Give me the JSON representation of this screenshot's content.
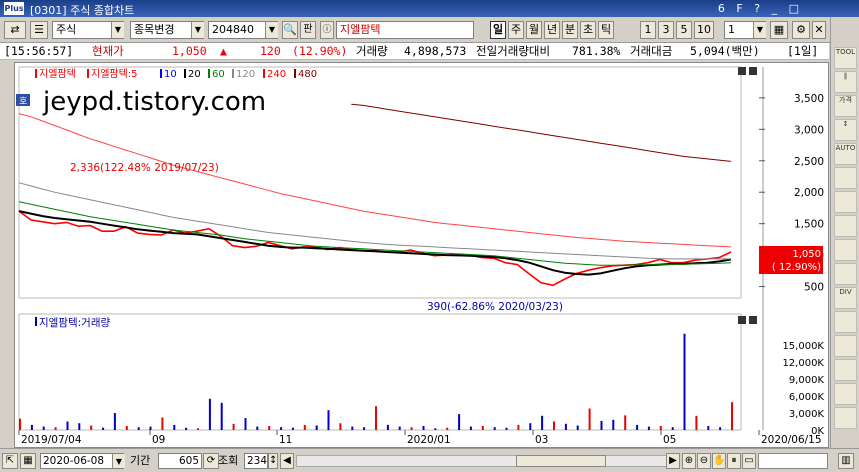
{
  "window": {
    "logo": "Plus",
    "title": "[0301] 주식 종합차트",
    "controls": [
      "6",
      "F",
      "?",
      "_",
      "□"
    ]
  },
  "toolbar": {
    "market": "주식",
    "search": "종목변경",
    "code": "204840",
    "pan_label": "판",
    "stock_name": "지엘팜텍",
    "periods": [
      "일",
      "주",
      "월",
      "년",
      "분",
      "초",
      "틱"
    ],
    "active_period": "일",
    "intervals": [
      "1",
      "3",
      "5",
      "10"
    ],
    "unit_value": "1"
  },
  "quote": {
    "time": "[15:56:57]",
    "price_label": "현재가",
    "price": "1,050",
    "arrow": "▲",
    "change": "120",
    "change_pct": "(12.90%)",
    "volume_label": "거래량",
    "volume": "4,898,573",
    "prev_vol_label": "전일거래량대비",
    "prev_vol_ratio": "781.38%",
    "amount_label": "거래대금",
    "amount": "5,094(백만)",
    "period_badge": "[1일]"
  },
  "chart_data": [
    {
      "type": "line",
      "legend": [
        "지엘팜텍",
        "지엘팜텍:5",
        "10",
        "20",
        "60",
        "120",
        "240",
        "480"
      ],
      "legend_colors": [
        "#ff0000",
        "#ff0000",
        "#0000ff",
        "#000000",
        "#008000",
        "#888888",
        "#ff0000",
        "#800000"
      ],
      "watermark": "jeypd.tistory.com",
      "yaxis_ticks": [
        "3,500",
        "3,000",
        "2,500",
        "2,000",
        "1,500",
        "1,000",
        "500"
      ],
      "ylim": [
        350,
        3800
      ],
      "xaxis_ticks": [
        "2019/07/04",
        "09",
        "11",
        "2020/01",
        "03",
        "05",
        "2020/06/15"
      ],
      "annotations": {
        "high": "2,336(122.48% 2019/07/23)",
        "low": "390(-62.86% 2020/03/23)"
      },
      "current_price": "1,050",
      "current_pct": "( 12.90%)",
      "series": [
        {
          "name": "지엘팜텍",
          "color": "#ff0000",
          "values": [
            1700,
            1560,
            1530,
            1500,
            1520,
            1460,
            1470,
            1380,
            1380,
            1450,
            1350,
            1330,
            1320,
            1400,
            1350,
            1380,
            1420,
            1300,
            1150,
            1120,
            1140,
            1200,
            1150,
            1100,
            1130,
            1130,
            1090,
            1120,
            1090,
            1070,
            1070,
            1050,
            1050,
            1080,
            1030,
            990,
            1000,
            1000,
            1000,
            960,
            950,
            880,
            850,
            700,
            560,
            520,
            620,
            710,
            760,
            800,
            830,
            840,
            850,
            880,
            930,
            880,
            880,
            920,
            940,
            960,
            1050
          ]
        },
        {
          "name": "20",
          "color": "#000000",
          "values": [
            1700,
            1660,
            1620,
            1590,
            1570,
            1550,
            1530,
            1500,
            1470,
            1440,
            1410,
            1390,
            1370,
            1350,
            1340,
            1330,
            1300,
            1270,
            1240,
            1210,
            1180,
            1150,
            1130,
            1120,
            1120,
            1110,
            1100,
            1090,
            1080,
            1070,
            1060,
            1050,
            1040,
            1030,
            1020,
            1010,
            1000,
            995,
            990,
            980,
            970,
            950,
            920,
            880,
            820,
            760,
            720,
            700,
            690,
            710,
            750,
            790,
            820,
            840,
            850,
            860,
            860,
            870,
            880,
            900,
            930
          ]
        },
        {
          "name": "60",
          "color": "#008000",
          "values": [
            1850,
            1810,
            1770,
            1730,
            1690,
            1650,
            1610,
            1580,
            1550,
            1520,
            1490,
            1460,
            1430,
            1400,
            1380,
            1360,
            1340,
            1320,
            1290,
            1260,
            1240,
            1220,
            1200,
            1180,
            1160,
            1140,
            1130,
            1120,
            1110,
            1100,
            1090,
            1080,
            1070,
            1060,
            1050,
            1040,
            1030,
            1020,
            1010,
            1000,
            990,
            970,
            950,
            930,
            910,
            890,
            870,
            860,
            850,
            840,
            840,
            840,
            845,
            850,
            850,
            850,
            855,
            860,
            865,
            870,
            880
          ]
        },
        {
          "name": "120",
          "color": "#888888",
          "values": [
            2150,
            2100,
            2050,
            2000,
            1960,
            1920,
            1880,
            1840,
            1800,
            1760,
            1720,
            1680,
            1640,
            1600,
            1570,
            1540,
            1510,
            1480,
            1450,
            1420,
            1390,
            1360,
            1340,
            1320,
            1300,
            1280,
            1260,
            1240,
            1220,
            1200,
            1185,
            1170,
            1160,
            1150,
            1140,
            1130,
            1120,
            1110,
            1100,
            1090,
            1080,
            1070,
            1060,
            1050,
            1040,
            1030,
            1020,
            1010,
            1000,
            990,
            980,
            970,
            960,
            950,
            945,
            940,
            940,
            940,
            940,
            940,
            940
          ]
        },
        {
          "name": "240",
          "color": "#ff4444",
          "values": [
            3250,
            3200,
            3130,
            3060,
            2990,
            2920,
            2850,
            2790,
            2730,
            2670,
            2610,
            2550,
            2490,
            2430,
            2380,
            2330,
            2280,
            2230,
            2180,
            2130,
            2080,
            2030,
            1980,
            1940,
            1900,
            1860,
            1820,
            1780,
            1740,
            1700,
            1670,
            1640,
            1610,
            1580,
            1550,
            1520,
            1500,
            1480,
            1460,
            1440,
            1420,
            1400,
            1380,
            1360,
            1340,
            1320,
            1300,
            1280,
            1265,
            1250,
            1235,
            1220,
            1210,
            1200,
            1190,
            1180,
            1170,
            1160,
            1150,
            1140,
            1130
          ]
        },
        {
          "name": "480",
          "color": "#800000",
          "values": [
            null,
            null,
            null,
            null,
            null,
            null,
            null,
            null,
            null,
            null,
            null,
            null,
            null,
            null,
            null,
            null,
            null,
            null,
            null,
            null,
            null,
            null,
            null,
            null,
            null,
            null,
            null,
            null,
            3400,
            3380,
            3350,
            3320,
            3290,
            3260,
            3230,
            3200,
            3170,
            3140,
            3110,
            3080,
            3050,
            3020,
            2990,
            2960,
            2930,
            2900,
            2870,
            2840,
            2810,
            2780,
            2750,
            2720,
            2690,
            2660,
            2630,
            2600,
            2570,
            2550,
            2530,
            2510,
            2490
          ]
        }
      ]
    },
    {
      "type": "bar",
      "legend": [
        "지엘팜텍:거래량"
      ],
      "yaxis_ticks": [
        "15,000K",
        "12,000K",
        "9,000K",
        "6,000K",
        "3,000K",
        "0K"
      ],
      "ylim": [
        0,
        18000
      ],
      "series": [
        {
          "name": "지엘팜텍:거래량",
          "values": [
            2000,
            900,
            600,
            500,
            1500,
            1200,
            800,
            400,
            3000,
            700,
            500,
            600,
            2200,
            900,
            400,
            300,
            5500,
            4800,
            1100,
            2100,
            600,
            700,
            500,
            400,
            900,
            800,
            3500,
            1200,
            600,
            500,
            4200,
            900,
            600,
            500,
            700,
            300,
            400,
            2800,
            600,
            700,
            500,
            400,
            900,
            1200,
            2500,
            1500,
            1100,
            800,
            3800,
            1600,
            1800,
            2600,
            900,
            600,
            700,
            500,
            17000,
            2500,
            700,
            500,
            4900
          ]
        }
      ]
    }
  ],
  "bottom": {
    "date": "2020-06-08",
    "period_label": "기간",
    "period": "605",
    "zoom_label": "조회",
    "zoom": "234"
  },
  "rightbar": [
    "TOOL",
    "∥",
    "가격",
    "↕",
    "AUTO",
    "",
    "",
    "",
    "",
    "",
    "DIV",
    "",
    "",
    "",
    "",
    ""
  ]
}
